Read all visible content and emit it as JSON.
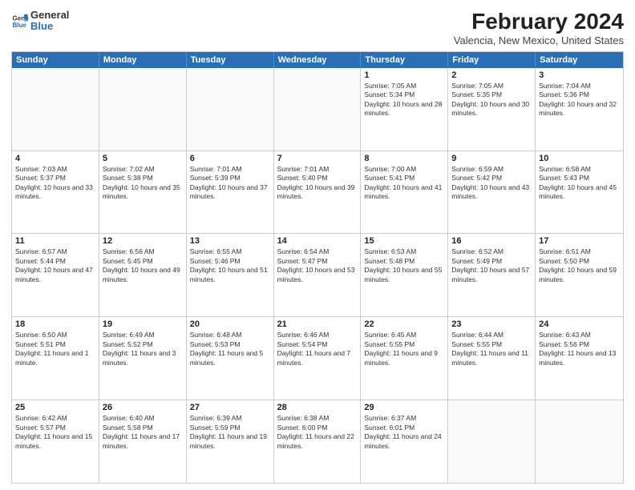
{
  "logo": {
    "general": "General",
    "blue": "Blue"
  },
  "title": "February 2024",
  "subtitle": "Valencia, New Mexico, United States",
  "days": [
    "Sunday",
    "Monday",
    "Tuesday",
    "Wednesday",
    "Thursday",
    "Friday",
    "Saturday"
  ],
  "rows": [
    [
      {
        "day": "",
        "info": ""
      },
      {
        "day": "",
        "info": ""
      },
      {
        "day": "",
        "info": ""
      },
      {
        "day": "",
        "info": ""
      },
      {
        "day": "1",
        "info": "Sunrise: 7:05 AM\nSunset: 5:34 PM\nDaylight: 10 hours and 28 minutes."
      },
      {
        "day": "2",
        "info": "Sunrise: 7:05 AM\nSunset: 5:35 PM\nDaylight: 10 hours and 30 minutes."
      },
      {
        "day": "3",
        "info": "Sunrise: 7:04 AM\nSunset: 5:36 PM\nDaylight: 10 hours and 32 minutes."
      }
    ],
    [
      {
        "day": "4",
        "info": "Sunrise: 7:03 AM\nSunset: 5:37 PM\nDaylight: 10 hours and 33 minutes."
      },
      {
        "day": "5",
        "info": "Sunrise: 7:02 AM\nSunset: 5:38 PM\nDaylight: 10 hours and 35 minutes."
      },
      {
        "day": "6",
        "info": "Sunrise: 7:01 AM\nSunset: 5:39 PM\nDaylight: 10 hours and 37 minutes."
      },
      {
        "day": "7",
        "info": "Sunrise: 7:01 AM\nSunset: 5:40 PM\nDaylight: 10 hours and 39 minutes."
      },
      {
        "day": "8",
        "info": "Sunrise: 7:00 AM\nSunset: 5:41 PM\nDaylight: 10 hours and 41 minutes."
      },
      {
        "day": "9",
        "info": "Sunrise: 6:59 AM\nSunset: 5:42 PM\nDaylight: 10 hours and 43 minutes."
      },
      {
        "day": "10",
        "info": "Sunrise: 6:58 AM\nSunset: 5:43 PM\nDaylight: 10 hours and 45 minutes."
      }
    ],
    [
      {
        "day": "11",
        "info": "Sunrise: 6:57 AM\nSunset: 5:44 PM\nDaylight: 10 hours and 47 minutes."
      },
      {
        "day": "12",
        "info": "Sunrise: 6:56 AM\nSunset: 5:45 PM\nDaylight: 10 hours and 49 minutes."
      },
      {
        "day": "13",
        "info": "Sunrise: 6:55 AM\nSunset: 5:46 PM\nDaylight: 10 hours and 51 minutes."
      },
      {
        "day": "14",
        "info": "Sunrise: 6:54 AM\nSunset: 5:47 PM\nDaylight: 10 hours and 53 minutes."
      },
      {
        "day": "15",
        "info": "Sunrise: 6:53 AM\nSunset: 5:48 PM\nDaylight: 10 hours and 55 minutes."
      },
      {
        "day": "16",
        "info": "Sunrise: 6:52 AM\nSunset: 5:49 PM\nDaylight: 10 hours and 57 minutes."
      },
      {
        "day": "17",
        "info": "Sunrise: 6:51 AM\nSunset: 5:50 PM\nDaylight: 10 hours and 59 minutes."
      }
    ],
    [
      {
        "day": "18",
        "info": "Sunrise: 6:50 AM\nSunset: 5:51 PM\nDaylight: 11 hours and 1 minute."
      },
      {
        "day": "19",
        "info": "Sunrise: 6:49 AM\nSunset: 5:52 PM\nDaylight: 11 hours and 3 minutes."
      },
      {
        "day": "20",
        "info": "Sunrise: 6:48 AM\nSunset: 5:53 PM\nDaylight: 11 hours and 5 minutes."
      },
      {
        "day": "21",
        "info": "Sunrise: 6:46 AM\nSunset: 5:54 PM\nDaylight: 11 hours and 7 minutes."
      },
      {
        "day": "22",
        "info": "Sunrise: 6:45 AM\nSunset: 5:55 PM\nDaylight: 11 hours and 9 minutes."
      },
      {
        "day": "23",
        "info": "Sunrise: 6:44 AM\nSunset: 5:55 PM\nDaylight: 11 hours and 11 minutes."
      },
      {
        "day": "24",
        "info": "Sunrise: 6:43 AM\nSunset: 5:56 PM\nDaylight: 11 hours and 13 minutes."
      }
    ],
    [
      {
        "day": "25",
        "info": "Sunrise: 6:42 AM\nSunset: 5:57 PM\nDaylight: 11 hours and 15 minutes."
      },
      {
        "day": "26",
        "info": "Sunrise: 6:40 AM\nSunset: 5:58 PM\nDaylight: 11 hours and 17 minutes."
      },
      {
        "day": "27",
        "info": "Sunrise: 6:39 AM\nSunset: 5:59 PM\nDaylight: 11 hours and 19 minutes."
      },
      {
        "day": "28",
        "info": "Sunrise: 6:38 AM\nSunset: 6:00 PM\nDaylight: 11 hours and 22 minutes."
      },
      {
        "day": "29",
        "info": "Sunrise: 6:37 AM\nSunset: 6:01 PM\nDaylight: 11 hours and 24 minutes."
      },
      {
        "day": "",
        "info": ""
      },
      {
        "day": "",
        "info": ""
      }
    ]
  ]
}
